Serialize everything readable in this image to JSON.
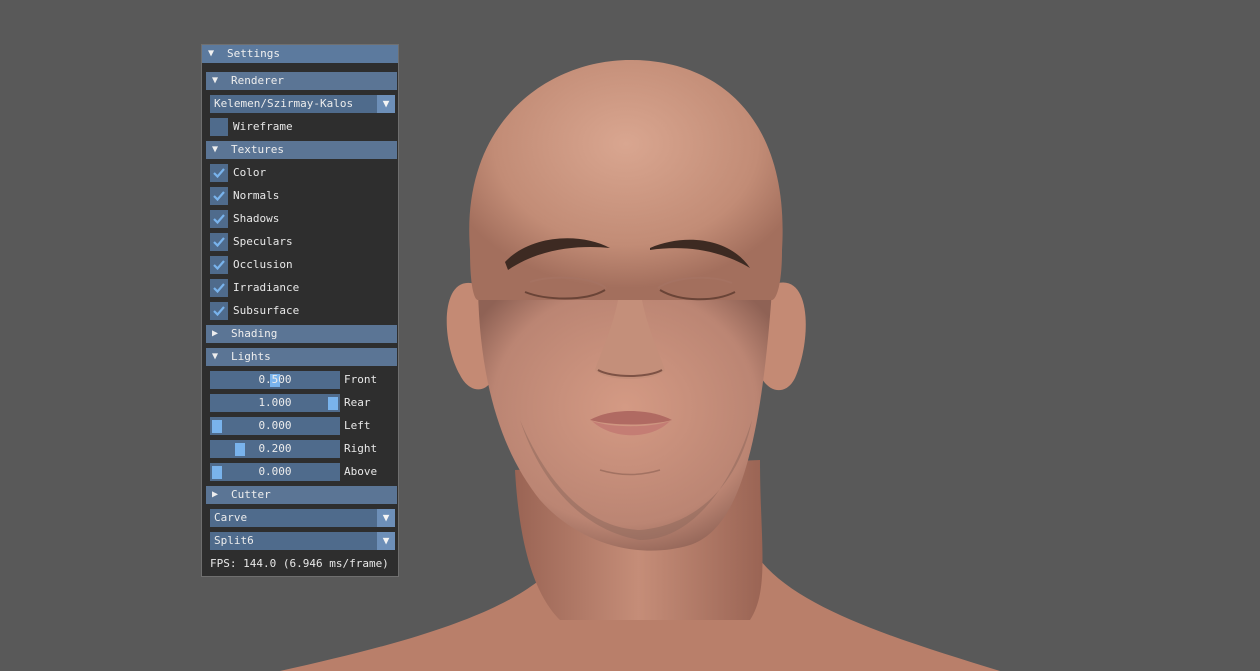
{
  "window": {
    "title": "Settings"
  },
  "renderer": {
    "header": "Renderer",
    "combo_value": "Kelemen/Szirmay-Kalos",
    "wireframe": {
      "label": "Wireframe",
      "checked": false
    }
  },
  "textures": {
    "header": "Textures",
    "items": [
      {
        "label": "Color",
        "checked": true
      },
      {
        "label": "Normals",
        "checked": true
      },
      {
        "label": "Shadows",
        "checked": true
      },
      {
        "label": "Speculars",
        "checked": true
      },
      {
        "label": "Occlusion",
        "checked": true
      },
      {
        "label": "Irradiance",
        "checked": true
      },
      {
        "label": "Subsurface",
        "checked": true
      }
    ]
  },
  "shading": {
    "header": "Shading",
    "expanded": false
  },
  "lights": {
    "header": "Lights",
    "sliders": [
      {
        "label": "Front",
        "display": "0.500",
        "value": 0.5,
        "min": 0,
        "max": 1
      },
      {
        "label": "Rear",
        "display": "1.000",
        "value": 1.0,
        "min": 0,
        "max": 1
      },
      {
        "label": "Left",
        "display": "0.000",
        "value": 0.0,
        "min": 0,
        "max": 1
      },
      {
        "label": "Right",
        "display": "0.200",
        "value": 0.2,
        "min": 0,
        "max": 1
      },
      {
        "label": "Above",
        "display": "0.000",
        "value": 0.0,
        "min": 0,
        "max": 1
      }
    ]
  },
  "cutter": {
    "header": "Cutter",
    "expanded": false,
    "mode_value": "Carve",
    "split_value": "Split6"
  },
  "status": {
    "fps": "FPS: 144.0 (6.946 ms/frame)"
  },
  "icons": {
    "expanded": "triangle-down-icon",
    "collapsed": "triangle-right-icon",
    "combo": "dropdown-arrow-icon",
    "check": "checkmark-icon"
  },
  "colors": {
    "background": "#595959",
    "header": "#5b7595",
    "frame": "#4f6b8c",
    "accent": "#79b3ec",
    "check": "#79b3ec"
  }
}
